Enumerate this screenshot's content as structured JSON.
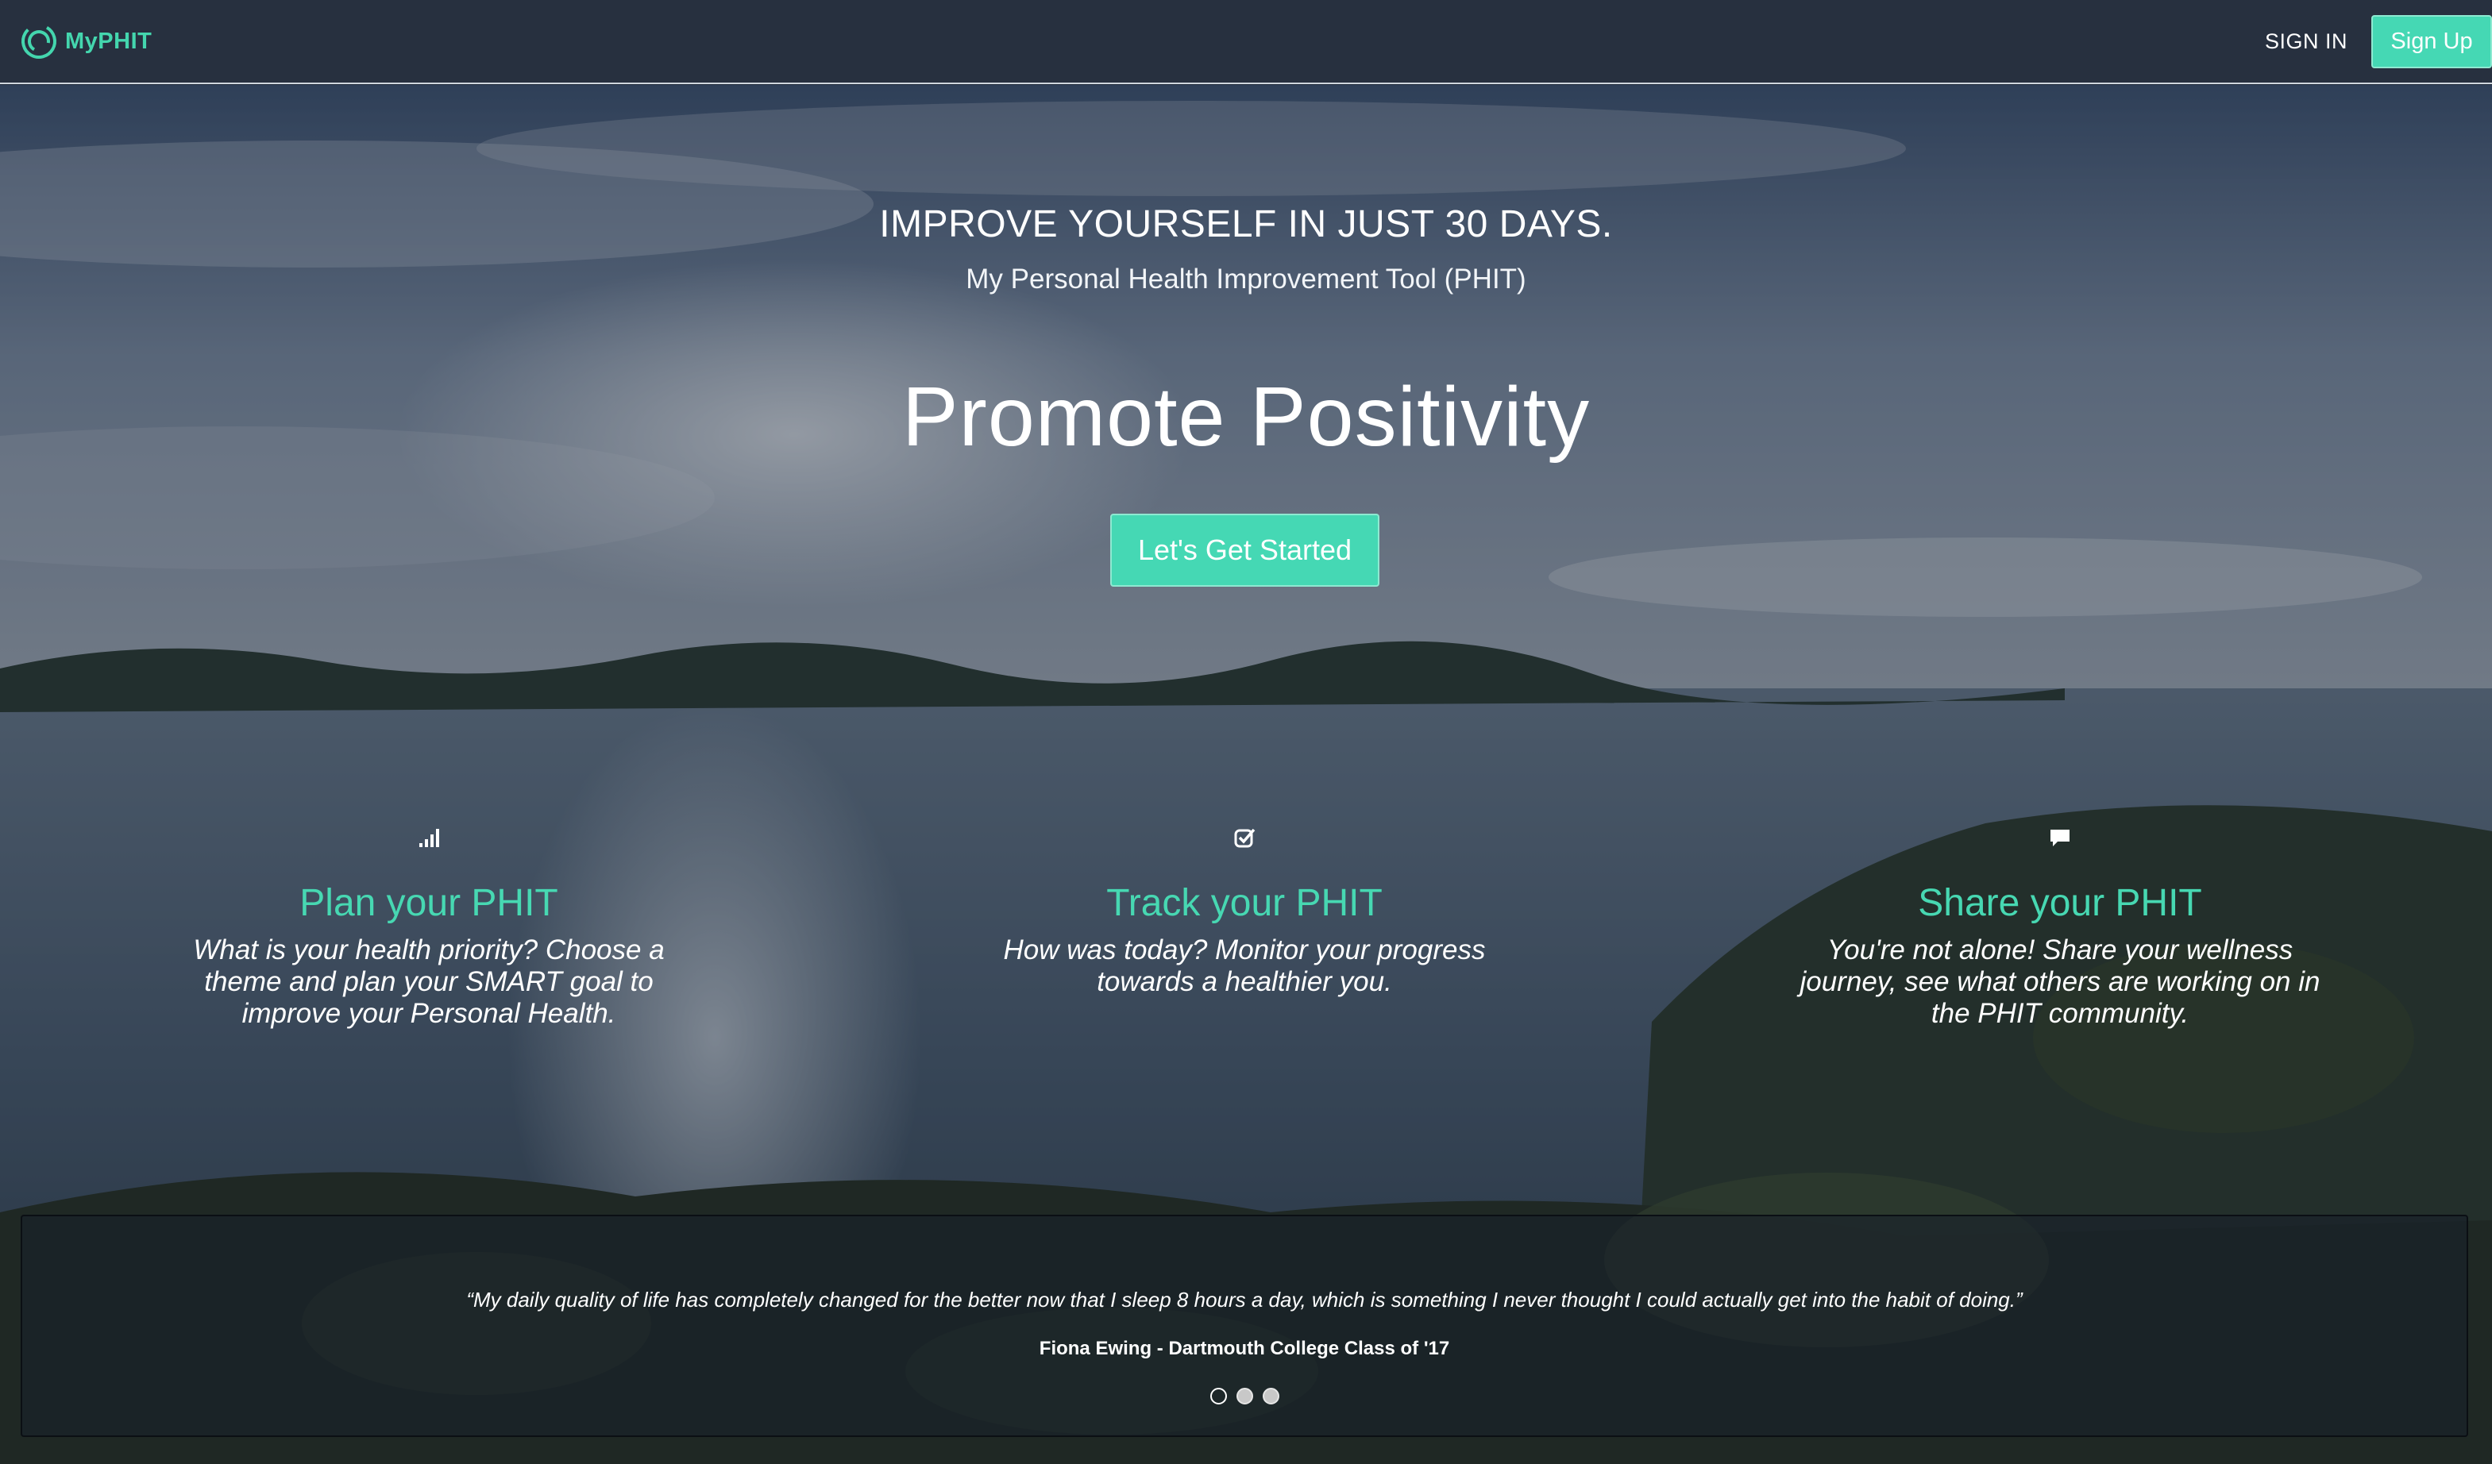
{
  "nav": {
    "brand": "MyPHIT",
    "sign_in": "SIGN IN",
    "sign_up": "Sign Up"
  },
  "hero": {
    "headline": "IMPROVE YOURSELF IN JUST 30 DAYS.",
    "subheadline": "My Personal Health Improvement Tool (PHIT)",
    "tagline": "Promote Positivity",
    "cta": "Let's Get Started"
  },
  "features": [
    {
      "icon": "bar-chart-icon",
      "title": "Plan your PHIT",
      "description": "What is your health priority? Choose a theme and plan your SMART goal to improve your Personal Health."
    },
    {
      "icon": "checkbox-icon",
      "title": "Track your PHIT",
      "description": "How was today? Monitor your progress towards a healthier you."
    },
    {
      "icon": "chat-bubble-icon",
      "title": "Share your PHIT",
      "description": "You're not alone! Share your wellness journey, see what others are working on in the PHIT community."
    }
  ],
  "testimonial": {
    "quote": "“My daily quality of life has completely changed for the better now that I sleep 8 hours a day, which is something I never thought I could actually get into the habit of doing.”",
    "author": "Fiona Ewing - Dartmouth College Class of '17",
    "active_slide": 1,
    "slide_count": 3
  },
  "colors": {
    "accent": "#45d8b4",
    "navbar": "#27303f",
    "feature_title": "#47d8b2"
  }
}
